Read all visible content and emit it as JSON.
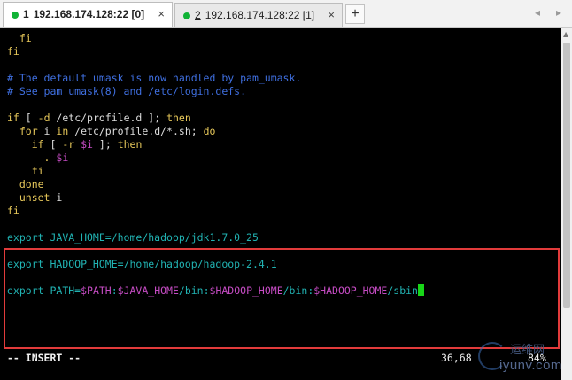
{
  "tabs": [
    {
      "num": "1",
      "title": "192.168.174.128:22 [0]",
      "close": "×",
      "active": true
    },
    {
      "num": "2",
      "title": "192.168.174.128:22 [1]",
      "close": "×",
      "active": false
    }
  ],
  "new_tab_label": "+",
  "nav": {
    "prev": "◂",
    "next": "▸"
  },
  "colors": {
    "keyword": "#e7c85a",
    "comment": "#3f6fe0",
    "variable": "#c64cc4",
    "export_cmd": "#21b3b3",
    "cursor": "#18d618",
    "highlight_box": "#e23b3b",
    "tab_dot": "#10b336"
  },
  "editor": {
    "lines": [
      [
        {
          "t": "  fi",
          "c": "kw"
        }
      ],
      [
        {
          "t": "fi",
          "c": "kw"
        }
      ],
      [],
      [
        {
          "t": "# The default umask is now handled by pam_umask.",
          "c": "cm"
        }
      ],
      [
        {
          "t": "# See pam_umask(8) and /etc/login.defs.",
          "c": "cm"
        }
      ],
      [],
      [
        {
          "t": "if",
          "c": "kw"
        },
        {
          "t": " [ ",
          "c": "plain"
        },
        {
          "t": "-d",
          "c": "kw"
        },
        {
          "t": " /etc/profile.d ]; ",
          "c": "plain"
        },
        {
          "t": "then",
          "c": "kw"
        }
      ],
      [
        {
          "t": "  for",
          "c": "kw"
        },
        {
          "t": " i ",
          "c": "plain"
        },
        {
          "t": "in",
          "c": "kw"
        },
        {
          "t": " /etc/profile.d/*.sh; ",
          "c": "plain"
        },
        {
          "t": "do",
          "c": "kw"
        }
      ],
      [
        {
          "t": "    if",
          "c": "kw"
        },
        {
          "t": " [ ",
          "c": "plain"
        },
        {
          "t": "-r",
          "c": "kw"
        },
        {
          "t": " ",
          "c": "plain"
        },
        {
          "t": "$i",
          "c": "vr"
        },
        {
          "t": " ]; ",
          "c": "plain"
        },
        {
          "t": "then",
          "c": "kw"
        }
      ],
      [
        {
          "t": "      .",
          "c": "kw"
        },
        {
          "t": " ",
          "c": "plain"
        },
        {
          "t": "$i",
          "c": "vr"
        }
      ],
      [
        {
          "t": "    fi",
          "c": "kw"
        }
      ],
      [
        {
          "t": "  done",
          "c": "kw"
        }
      ],
      [
        {
          "t": "  unset",
          "c": "kw"
        },
        {
          "t": " i",
          "c": "plain"
        }
      ],
      [
        {
          "t": "fi",
          "c": "kw"
        }
      ],
      [],
      [
        {
          "t": "export",
          "c": "cmd"
        },
        {
          "t": " JAVA_HOME=/home/hadoop/jdk1.7.0_25",
          "c": "cmd"
        }
      ],
      [],
      [
        {
          "t": "export",
          "c": "cmd"
        },
        {
          "t": " HADOOP_HOME=/home/hadoop/hadoop-2.4.1",
          "c": "cmd"
        }
      ],
      [],
      [
        {
          "t": "export",
          "c": "cmd"
        },
        {
          "t": " PATH=",
          "c": "cmd"
        },
        {
          "t": "$PATH",
          "c": "vr"
        },
        {
          "t": ":",
          "c": "cmd"
        },
        {
          "t": "$JAVA_HOME",
          "c": "vr"
        },
        {
          "t": "/bin:",
          "c": "cmd"
        },
        {
          "t": "$HADOOP_HOME",
          "c": "vr"
        },
        {
          "t": "/bin:",
          "c": "cmd"
        },
        {
          "t": "$HADOOP_HOME",
          "c": "vr"
        },
        {
          "t": "/sbin",
          "c": "cmd"
        },
        {
          "cursor": true
        }
      ]
    ]
  },
  "status": {
    "mode": "-- INSERT --",
    "position": "36,68",
    "percent": "84%"
  },
  "watermark": {
    "cn": "运维网",
    "en": "iyunv.com"
  }
}
